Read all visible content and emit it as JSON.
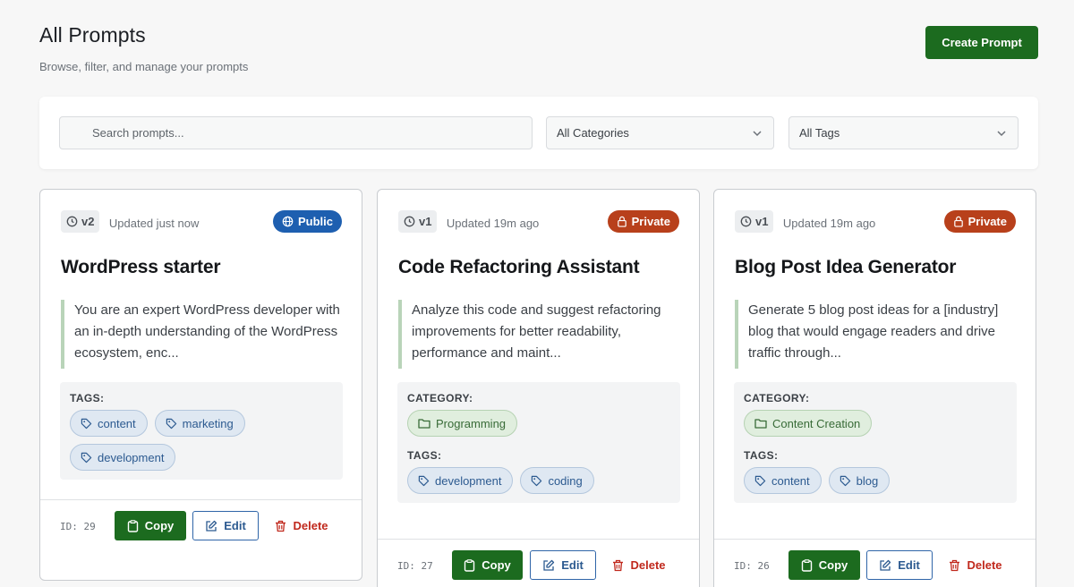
{
  "page": {
    "title": "All Prompts",
    "subtitle": "Browse, filter, and manage your prompts",
    "create_label": "Create Prompt"
  },
  "filters": {
    "search_placeholder": "Search prompts...",
    "category_value": "All Categories",
    "tags_value": "All Tags"
  },
  "labels": {
    "category": "CATEGORY:",
    "tags": "TAGS:",
    "copy": "Copy",
    "edit": "Edit",
    "delete": "Delete"
  },
  "colors": {
    "primary_green": "#1c6b1f",
    "public_blue": "#1e5fb0",
    "private_orange": "#b8401b",
    "delete_red": "#c0281c"
  },
  "cards": [
    {
      "version": "v2",
      "updated": "Updated just now",
      "visibility": "Public",
      "title": "WordPress starter",
      "description": "You are an expert WordPress developer with an in-depth understanding of the WordPress ecosystem, enc...",
      "tags": [
        "content",
        "marketing",
        "development"
      ],
      "id_label": "ID: 29"
    },
    {
      "version": "v1",
      "updated": "Updated 19m ago",
      "visibility": "Private",
      "title": "Code Refactoring Assistant",
      "description": "Analyze this code and suggest refactoring improvements for better readability, performance and maint...",
      "category": "Programming",
      "tags": [
        "development",
        "coding"
      ],
      "id_label": "ID: 27"
    },
    {
      "version": "v1",
      "updated": "Updated 19m ago",
      "visibility": "Private",
      "title": "Blog Post Idea Generator",
      "description": "Generate 5 blog post ideas for a [industry] blog that would engage readers and drive traffic through...",
      "category": "Content Creation",
      "tags": [
        "content",
        "blog"
      ],
      "id_label": "ID: 26"
    }
  ]
}
